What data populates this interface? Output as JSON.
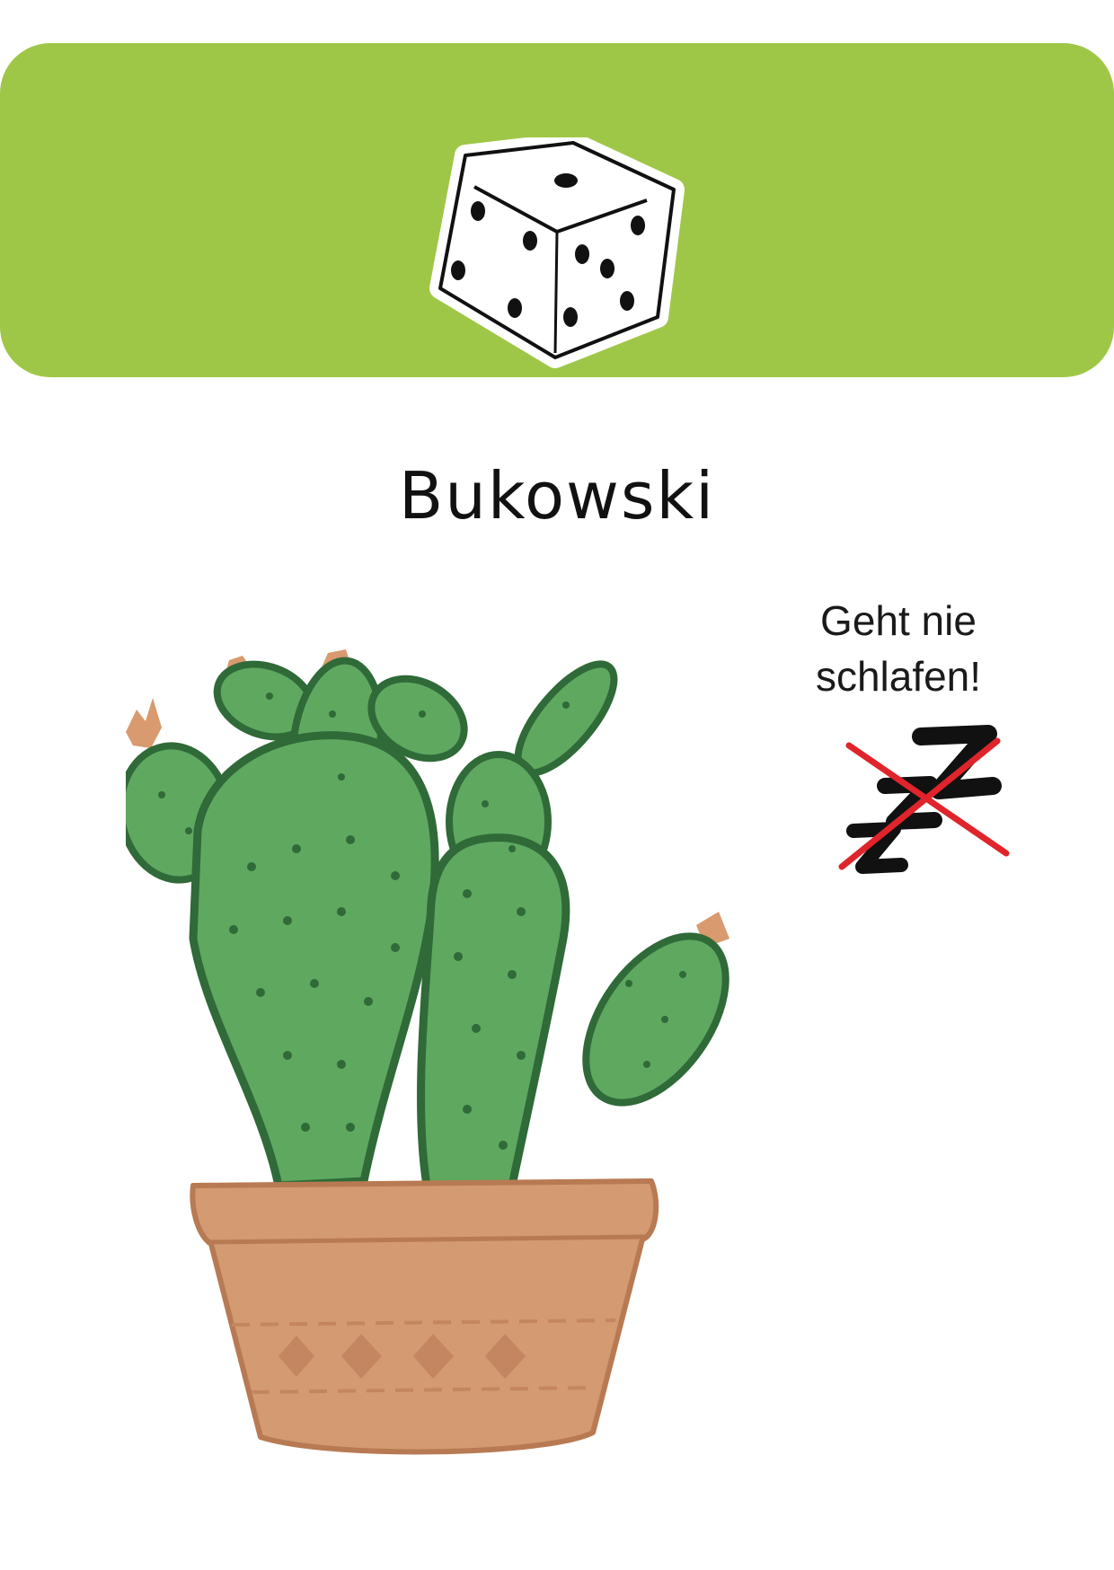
{
  "colors": {
    "header_bg": "#9fc747",
    "cactus_green": "#5fa860",
    "cactus_dark": "#2f6a38",
    "pot": "#d49a72",
    "pot_dark": "#b87a52",
    "flower": "#d89a6e",
    "cross_red": "#e0242b"
  },
  "icons": {
    "dice": "dice-icon",
    "sleep": "zzz-crossed-icon"
  },
  "card": {
    "title": "Bukowski",
    "trait_line1": "Geht nie",
    "trait_line2": "schlafen!"
  }
}
